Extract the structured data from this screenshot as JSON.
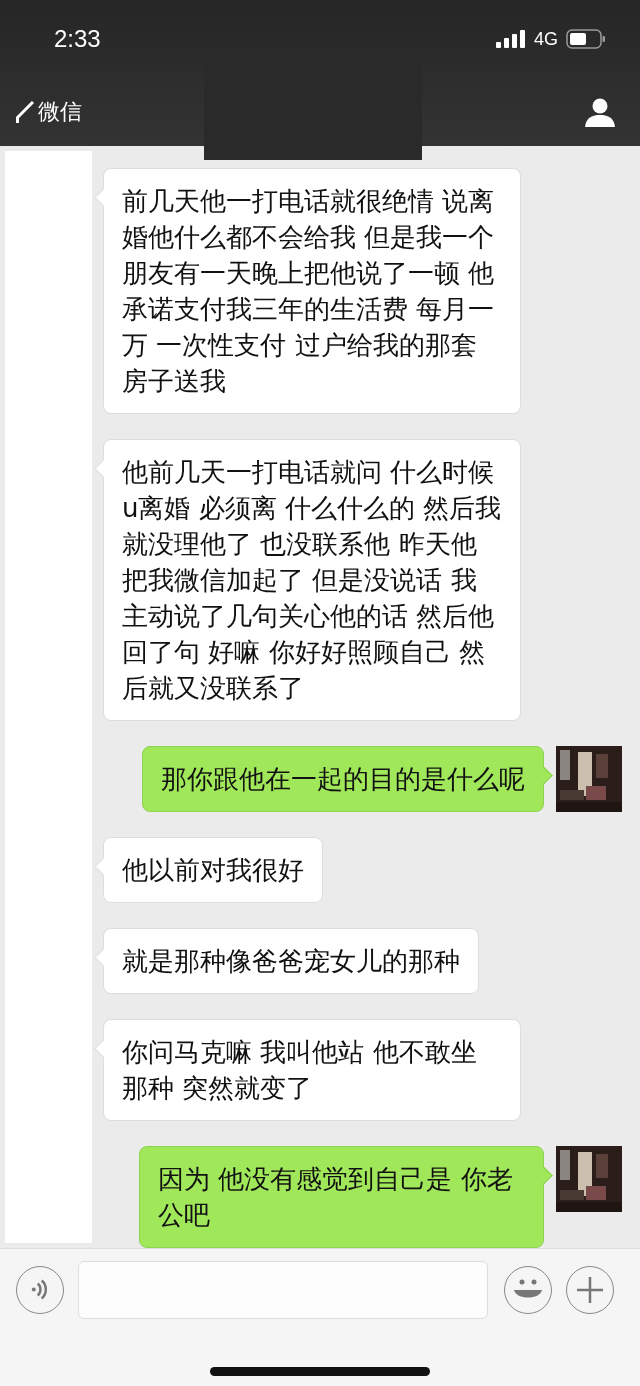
{
  "status_bar": {
    "time": "2:33",
    "network": "4G"
  },
  "nav": {
    "back_label": "微信"
  },
  "messages": [
    {
      "kind": "incoming",
      "text": "前几天他一打电话就很绝情 说离婚他什么都不会给我 但是我一个朋友有一天晚上把他说了一顿 他承诺支付我三年的生活费 每月一万 一次性支付 过户给我的那套房子送我"
    },
    {
      "kind": "incoming",
      "text": "他前几天一打电话就问 什么时候u离婚 必须离 什么什么的 然后我就没理他了 也没联系他 昨天他把我微信加起了 但是没说话 我主动说了几句关心他的话 然后他回了句 好嘛 你好好照顾自己 然后就又没联系了"
    },
    {
      "kind": "outgoing",
      "text": "那你跟他在一起的目的是什么呢"
    },
    {
      "kind": "incoming",
      "text": "他以前对我很好"
    },
    {
      "kind": "incoming",
      "text": "就是那种像爸爸宠女儿的那种"
    },
    {
      "kind": "incoming",
      "text": "你问马克嘛 我叫他站 他不敢坐那种 突然就变了"
    },
    {
      "kind": "outgoing",
      "text": "因为 他没有感觉到自己是 你老公吧"
    }
  ]
}
